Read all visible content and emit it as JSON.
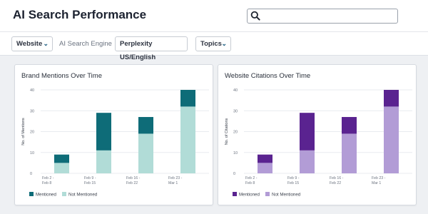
{
  "header": {
    "title": "AI Search Performance",
    "search_placeholder": ""
  },
  "filters": {
    "website_label": "Website",
    "engine_label": "AI Search Engine",
    "engine_value": "Perplexity US/English",
    "topics_label": "Topics"
  },
  "icons": {
    "search": "search-icon",
    "dropdown": "chevron-down-icon"
  },
  "colors": {
    "brand_primary": "#0e6c78",
    "brand_secondary": "#b1dcd7",
    "cite_primary": "#5a2390",
    "cite_secondary": "#b29cd6"
  },
  "chart_data": [
    {
      "type": "bar",
      "stacked": true,
      "title": "Brand Mentions Over Time",
      "ylabel": "No. of Mentions",
      "xlabel": "",
      "categories": [
        [
          "Feb 2 -",
          "Feb 8"
        ],
        [
          "Feb 9 -",
          "Feb 15"
        ],
        [
          "Feb 16 -",
          "Feb 22"
        ],
        [
          "Feb 23 -",
          "Mar 1"
        ]
      ],
      "ylim": [
        0,
        40
      ],
      "yticks": [
        0,
        10,
        20,
        30,
        40
      ],
      "grid": true,
      "legend_position": "bottom-left",
      "series": [
        {
          "name": "Not Mentioned",
          "values": [
            5,
            11,
            19,
            32
          ]
        },
        {
          "name": "Mentioned",
          "values": [
            4,
            18,
            8,
            8
          ]
        }
      ]
    },
    {
      "type": "bar",
      "stacked": true,
      "title": "Website Citations Over Time",
      "ylabel": "No. of Citations",
      "xlabel": "",
      "categories": [
        [
          "Feb 2 -",
          "Feb 8"
        ],
        [
          "Feb 9 -",
          "Feb 15"
        ],
        [
          "Feb 16 -",
          "Feb 22"
        ],
        [
          "Feb 23 -",
          "Mar 1"
        ]
      ],
      "ylim": [
        0,
        40
      ],
      "yticks": [
        0,
        10,
        20,
        30,
        40
      ],
      "grid": true,
      "legend_position": "bottom-left",
      "series": [
        {
          "name": "Not Mentioned",
          "values": [
            5,
            11,
            19,
            32
          ]
        },
        {
          "name": "Mentioned",
          "values": [
            4,
            18,
            8,
            8
          ]
        }
      ]
    }
  ]
}
